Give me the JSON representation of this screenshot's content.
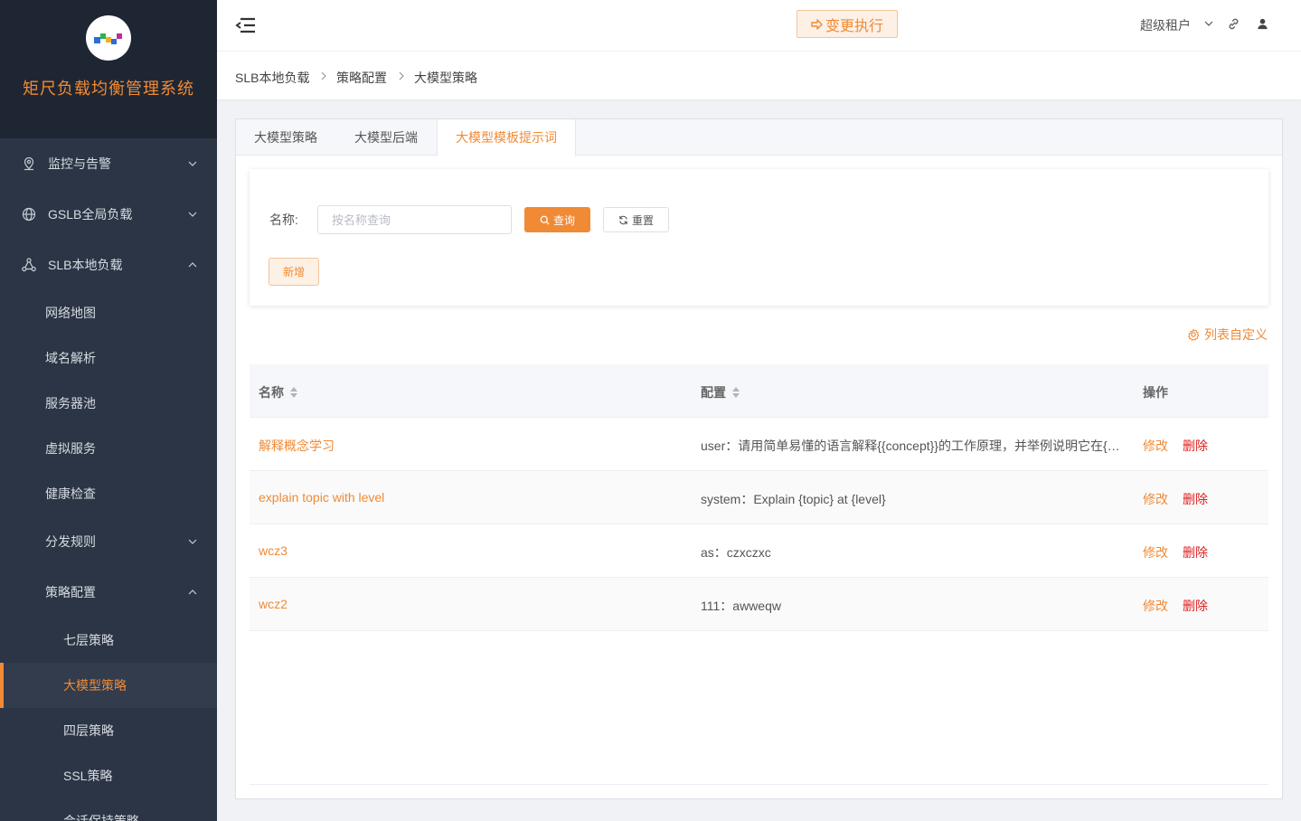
{
  "app": {
    "name": "矩尺负载均衡管理系统"
  },
  "sidebar": {
    "menus": [
      {
        "label": "监控与告警",
        "icon": "location-pin-icon",
        "expanded": false
      },
      {
        "label": "GSLB全局负载",
        "icon": "globe-icon",
        "expanded": false
      },
      {
        "label": "SLB本地负载",
        "icon": "network-nodes-icon",
        "expanded": true
      }
    ],
    "slb_items": [
      "网络地图",
      "域名解析",
      "服务器池",
      "虚拟服务",
      "健康检查"
    ],
    "dispatch_rules": "分发规则",
    "policy_config": "策略配置",
    "policy_items": [
      "七层策略",
      "大模型策略",
      "四层策略",
      "SSL策略",
      "会话保持策略"
    ],
    "active_item": "大模型策略"
  },
  "header": {
    "exec_button": "变更执行",
    "tenant": "超级租户"
  },
  "breadcrumb": [
    "SLB本地负载",
    "策略配置",
    "大模型策略"
  ],
  "tabs": [
    "大模型策略",
    "大模型后端",
    "大模型模板提示词"
  ],
  "active_tab": "大模型模板提示词",
  "search": {
    "name_label": "名称:",
    "name_placeholder": "按名称查询",
    "query_button": "查询",
    "reset_button": "重置",
    "add_button": "新增"
  },
  "customize_label": "列表自定义",
  "table": {
    "columns": [
      "名称",
      "配置",
      "操作"
    ],
    "edit_label": "修改",
    "delete_label": "删除",
    "rows": [
      {
        "name": "解释概念学习",
        "config": "user：请用简单易懂的语言解释{{concept}}的工作原理，并举例说明它在{{field}}领域中的应用"
      },
      {
        "name": "explain topic with level",
        "config": "system：Explain {topic} at {level}"
      },
      {
        "name": "wcz3",
        "config": "as：czxczxc"
      },
      {
        "name": "wcz2",
        "config": "111：awweqw"
      }
    ]
  },
  "colors": {
    "accent": "#f08a35",
    "sidebar_bg": "#2b3545",
    "danger": "#e02020"
  }
}
